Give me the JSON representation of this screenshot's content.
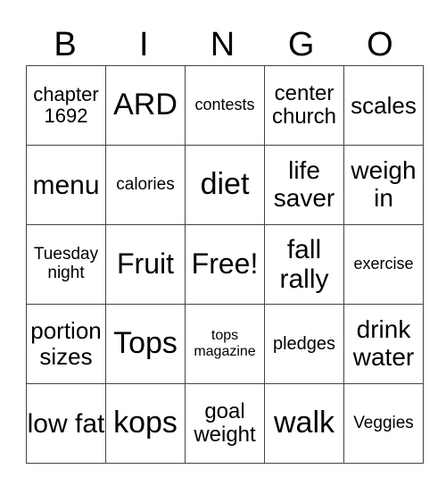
{
  "header": [
    "B",
    "I",
    "N",
    "G",
    "O"
  ],
  "rows": [
    [
      "chapter 1692",
      "ARD",
      "contests",
      "center church",
      "scales"
    ],
    [
      "menu",
      "calories",
      "diet",
      "life saver",
      "weigh in"
    ],
    [
      "Tuesday night",
      "Fruit",
      "Free!",
      "fall rally",
      "exercise"
    ],
    [
      "portion sizes",
      "Tops",
      "tops magazine",
      "pledges",
      "drink water"
    ],
    [
      "low fat",
      "kops",
      "goal weight",
      "walk",
      "Veggies"
    ]
  ]
}
